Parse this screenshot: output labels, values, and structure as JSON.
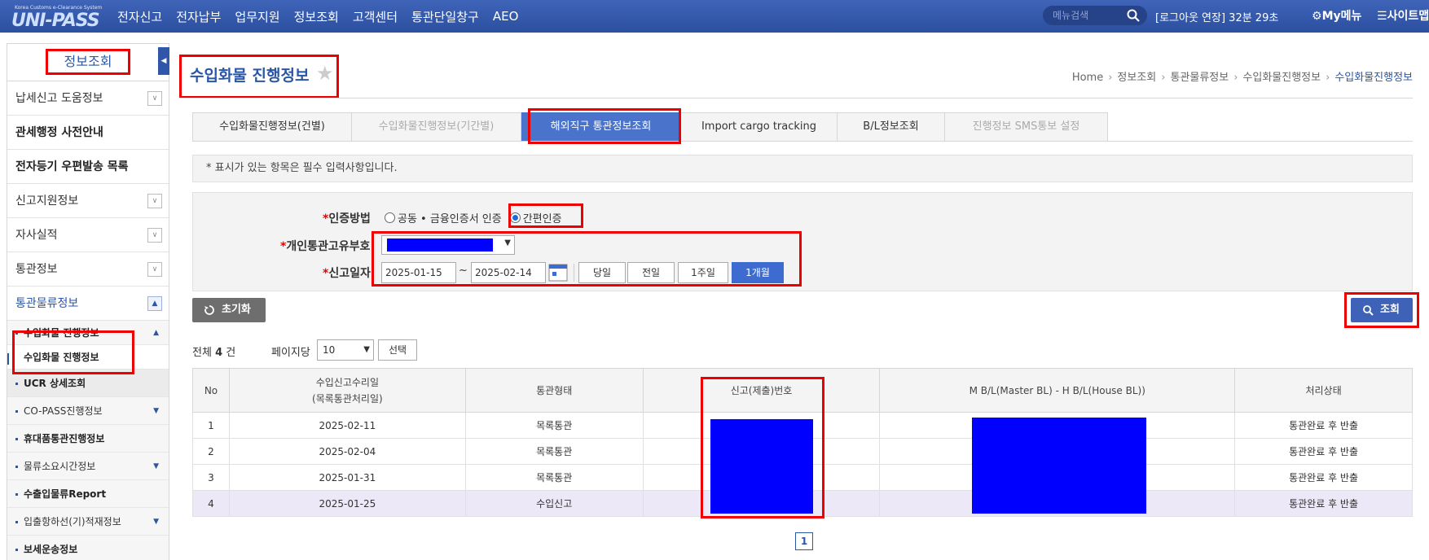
{
  "header": {
    "logo_tagline": "Korea Customs e-Clearance System",
    "logo_text": "UNI-PASS",
    "nav": [
      "전자신고",
      "전자납부",
      "업무지원",
      "정보조회",
      "고객센터",
      "통관단일창구",
      "AEO"
    ],
    "search_placeholder": "메뉴검색",
    "logout_timer": "[로그아웃 연장] 32분 29초",
    "mymenu_label": "My메뉴",
    "sitemap_label": "사이트맵"
  },
  "sidebar": {
    "title": "정보조회",
    "items": [
      {
        "label": "납세신고 도움정보"
      },
      {
        "label": "관세행정 사전안내"
      },
      {
        "label": "전자등기 우편발송 목록"
      },
      {
        "label": "신고지원정보"
      },
      {
        "label": "자사실적"
      },
      {
        "label": "통관정보"
      },
      {
        "label": "통관물류정보"
      }
    ],
    "sub": {
      "group": "수입화물 진행정보",
      "current": "수입화물 진행정보",
      "ucr": "UCR 상세조회",
      "copass": "CO-PASS진행정보",
      "baggage": "휴대품통관진행정보",
      "logistics_time": "물류소요시간정보",
      "report": "수출입물류Report",
      "vessel": "입출항하선(기)적재정보",
      "bonded": "보세운송정보"
    }
  },
  "page": {
    "title": "수입화물 진행정보",
    "breadcrumb": [
      "Home",
      "정보조회",
      "통관물류정보",
      "수입화물진행정보",
      "수입화물진행정보"
    ]
  },
  "tabs": [
    {
      "label": "수입화물진행정보(건별)"
    },
    {
      "label": "수입화물진행정보(기간별)"
    },
    {
      "label": "해외직구 통관정보조회"
    },
    {
      "label": "Import cargo tracking"
    },
    {
      "label": "B/L정보조회"
    },
    {
      "label": "진행정보 SMS통보 설정"
    }
  ],
  "notice": "* 표시가 있는 항목은 필수 입력사항입니다.",
  "form": {
    "auth_label": "인증방법",
    "auth_options": [
      "공동 • 금융인증서 인증",
      "간편인증"
    ],
    "pccc_label": "개인통관고유부호",
    "date_label": "신고일자",
    "date_from": "2025-01-15",
    "date_to": "2025-02-14",
    "tilde": "~",
    "periods": [
      "당일",
      "전일",
      "1주일",
      "1개월"
    ],
    "reset_label": "초기화",
    "search_label": "조회"
  },
  "list": {
    "total_prefix": "전체",
    "total_count": "4",
    "total_suffix": "건",
    "per_page_label": "페이지당",
    "per_page_value": "10",
    "choose_label": "선택",
    "columns": [
      "No",
      "수입신고수리일",
      "(목록통관처리일)",
      "통관형태",
      "신고(제출)번호",
      "M B/L(Master BL) - H B/L(House BL))",
      "처리상태"
    ],
    "rows": [
      {
        "no": "1",
        "date": "2025-02-11",
        "type": "목록통관",
        "status": "통관완료 후 반출"
      },
      {
        "no": "2",
        "date": "2025-02-04",
        "type": "목록통관",
        "status": "통관완료 후 반출"
      },
      {
        "no": "3",
        "date": "2025-01-31",
        "type": "목록통관",
        "status": "통관완료 후 반출"
      },
      {
        "no": "4",
        "date": "2025-01-25",
        "type": "수입신고",
        "status": "통관완료 후 반출"
      }
    ],
    "page": "1"
  },
  "colors": {
    "brand": "#2c4f9f",
    "accent": "#3d6bd0",
    "highlight": "#e00000"
  }
}
